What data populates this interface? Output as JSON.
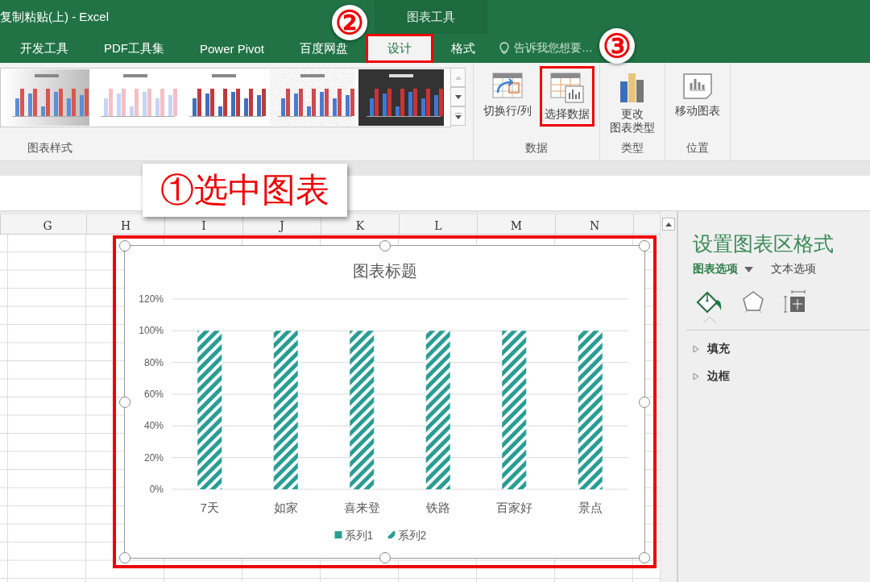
{
  "window": {
    "title": "复制粘贴(上) - Excel",
    "context_label": "图表工具"
  },
  "tabs": [
    {
      "label": "开发工具",
      "selected": false,
      "highlighted": false
    },
    {
      "label": "PDF工具集",
      "selected": false,
      "highlighted": false
    },
    {
      "label": "Power Pivot",
      "selected": false,
      "highlighted": false
    },
    {
      "label": "百度网盘",
      "selected": false,
      "highlighted": false
    },
    {
      "label": "设计",
      "selected": true,
      "highlighted": true,
      "step": "②"
    },
    {
      "label": "格式",
      "selected": false,
      "highlighted": false
    }
  ],
  "tell_me": {
    "placeholder": "告诉我您想要…"
  },
  "ribbon": {
    "gallery_label": "图表样式",
    "chart_styles": [
      {
        "kind": "gradient"
      },
      {
        "kind": "pale"
      },
      {
        "kind": "plain"
      },
      {
        "kind": "hatched"
      },
      {
        "kind": "dark"
      }
    ],
    "groups": [
      {
        "label": "数据",
        "buttons": [
          {
            "kind": "switch",
            "lines": [
              "切换行/列"
            ],
            "highlighted": false
          },
          {
            "kind": "select-data",
            "lines": [
              "选择数据"
            ],
            "highlighted": true,
            "step": "③"
          }
        ]
      },
      {
        "label": "类型",
        "buttons": [
          {
            "kind": "chart-type",
            "lines": [
              "更改",
              "图表类型"
            ],
            "highlighted": false
          }
        ]
      },
      {
        "label": "位置",
        "buttons": [
          {
            "kind": "move-chart",
            "lines": [
              "移动图表"
            ],
            "highlighted": false
          }
        ]
      }
    ]
  },
  "callout": "①选中图表",
  "sheet": {
    "columns": [
      "G",
      "H",
      "I",
      "J",
      "K",
      "L",
      "M",
      "N"
    ]
  },
  "chart": {
    "highlighted": true,
    "chart_data": {
      "type": "bar",
      "title": "图表标题",
      "categories": [
        "7天",
        "如家",
        "喜来登",
        "铁路",
        "百家好",
        "景点"
      ],
      "series": [
        {
          "name": "系列1",
          "color": "#2a9d94",
          "values": [
            null,
            null,
            null,
            null,
            null,
            null
          ]
        },
        {
          "name": "系列2",
          "color": "#2a9d94",
          "values": [
            1,
            1,
            1,
            1,
            1,
            1
          ]
        }
      ],
      "grid": true,
      "ylim": [
        0,
        1.2
      ],
      "yticks": [
        {
          "value": 0,
          "label": "0%"
        },
        {
          "value": 0.2,
          "label": "20%"
        },
        {
          "value": 0.4,
          "label": "40%"
        },
        {
          "value": 0.6,
          "label": "60%"
        },
        {
          "value": 0.8,
          "label": "80%"
        },
        {
          "value": 1,
          "label": "100%"
        },
        {
          "value": 1.2,
          "label": "120%"
        }
      ]
    }
  },
  "panel": {
    "title": "设置图表区格式",
    "tabs": [
      {
        "label": "图表选项",
        "selected": true
      },
      {
        "label": "文本选项",
        "selected": false
      }
    ],
    "icon_tabs": [
      {
        "kind": "fill",
        "selected": true
      },
      {
        "kind": "effects",
        "selected": false
      },
      {
        "kind": "size",
        "selected": false
      }
    ],
    "sections": [
      {
        "label": "填充",
        "expanded": false
      },
      {
        "label": "边框",
        "expanded": false
      }
    ]
  }
}
